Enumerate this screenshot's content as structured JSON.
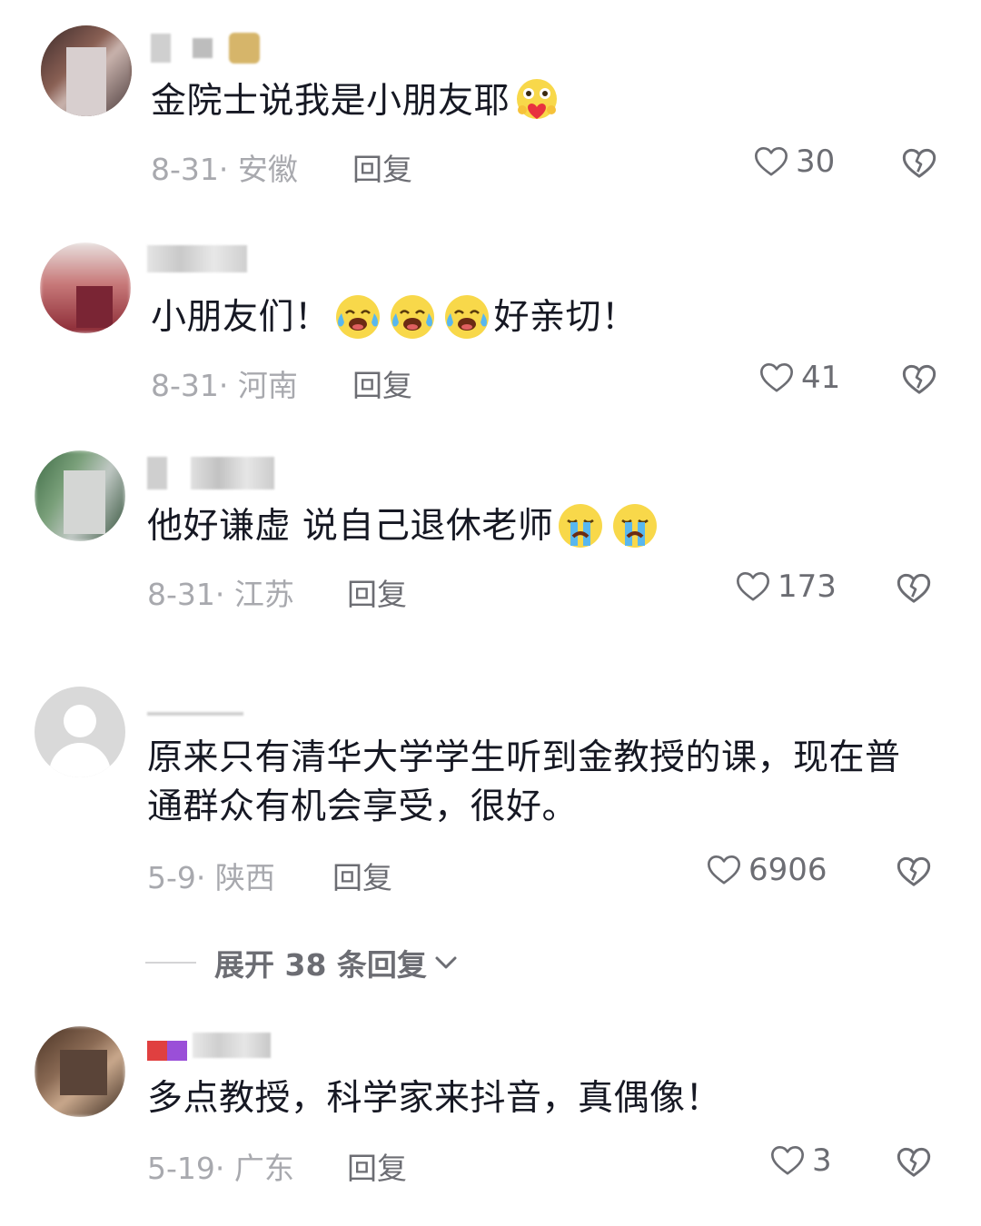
{
  "comments": [
    {
      "text": "金院士说我是小朋友耶",
      "date": "8-31",
      "location": "安徽",
      "reply_label": "回复",
      "likes": "30"
    },
    {
      "text_a": "小朋友们！",
      "text_b": "好亲切！",
      "date": "8-31",
      "location": "河南",
      "reply_label": "回复",
      "likes": "41"
    },
    {
      "text": "他好谦虚 说自己退休老师",
      "date": "8-31",
      "location": "江苏",
      "reply_label": "回复",
      "likes": "173"
    },
    {
      "text": "原来只有清华大学学生听到金教授的课，现在普通群众有机会享受，很好。",
      "date": "5-9",
      "location": "陕西",
      "reply_label": "回复",
      "likes": "6906"
    },
    {
      "text": "多点教授，科学家来抖音，真偶像！",
      "date": "5-19",
      "location": "广东",
      "reply_label": "回复",
      "likes": "3"
    }
  ],
  "expand_replies": "展开 38 条回复",
  "separator": "·",
  "icons": {
    "like": "heart-outline-icon",
    "dislike": "broken-heart-icon",
    "expand": "chevron-down-icon",
    "emoji_heart": "heart-hug-emoji-icon",
    "emoji_cry_laugh": "tears-of-joy-emoji-icon",
    "emoji_cry": "loudly-crying-emoji-icon"
  },
  "colors": {
    "text": "#161823",
    "meta": "#a8a9ae",
    "action": "#6c6d73"
  }
}
